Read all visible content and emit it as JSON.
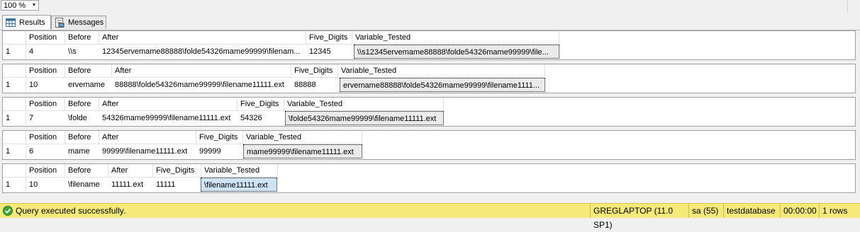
{
  "toolbar": {
    "zoom": "100 %"
  },
  "tabs": [
    {
      "label": "Results"
    },
    {
      "label": "Messages"
    }
  ],
  "grids": [
    {
      "headers": [
        "Position",
        "Before",
        "After",
        "Five_Digits",
        "Variable_Tested"
      ],
      "row": {
        "num": "1",
        "cells": [
          "4",
          "\\\\s",
          "12345ervemame88888\\folde54326mame99999\\filenam...",
          "12345",
          "\\\\s12345ervemame88888\\folde54326mame99999\\file..."
        ]
      }
    },
    {
      "headers": [
        "Position",
        "Before",
        "After",
        "Five_Digits",
        "Variable_Tested"
      ],
      "row": {
        "num": "1",
        "cells": [
          "10",
          "ervemame",
          "88888\\folde54326mame99999\\filename11111.ext",
          "88888",
          "ervemame88888\\folde54326mame99999\\filename1111..."
        ]
      }
    },
    {
      "headers": [
        "Position",
        "Before",
        "After",
        "Five_Digits",
        "Variable_Tested"
      ],
      "row": {
        "num": "1",
        "cells": [
          "7",
          "\\folde",
          "54326mame99999\\filename11111.ext",
          "54326",
          "\\folde54326mame99999\\filename11111.ext"
        ]
      }
    },
    {
      "headers": [
        "Position",
        "Before",
        "After",
        "Five_Digits",
        "Variable_Tested"
      ],
      "row": {
        "num": "1",
        "cells": [
          "6",
          "mame",
          "99999\\filename11111.ext",
          "99999",
          "mame99999\\filename11111.ext"
        ]
      }
    },
    {
      "headers": [
        "Position",
        "Before",
        "After",
        "Five_Digits",
        "Variable_Tested"
      ],
      "row": {
        "num": "1",
        "cells": [
          "10",
          "\\filename",
          "11111.ext",
          "11111",
          "\\filename11111.ext"
        ]
      }
    }
  ],
  "status": {
    "message": "Query executed successfully.",
    "server": "GREGLAPTOP (11.0 SP1)",
    "user": "sa (55)",
    "database": "testdatabase",
    "elapsed": "00:00:00",
    "rows": "1 rows"
  }
}
